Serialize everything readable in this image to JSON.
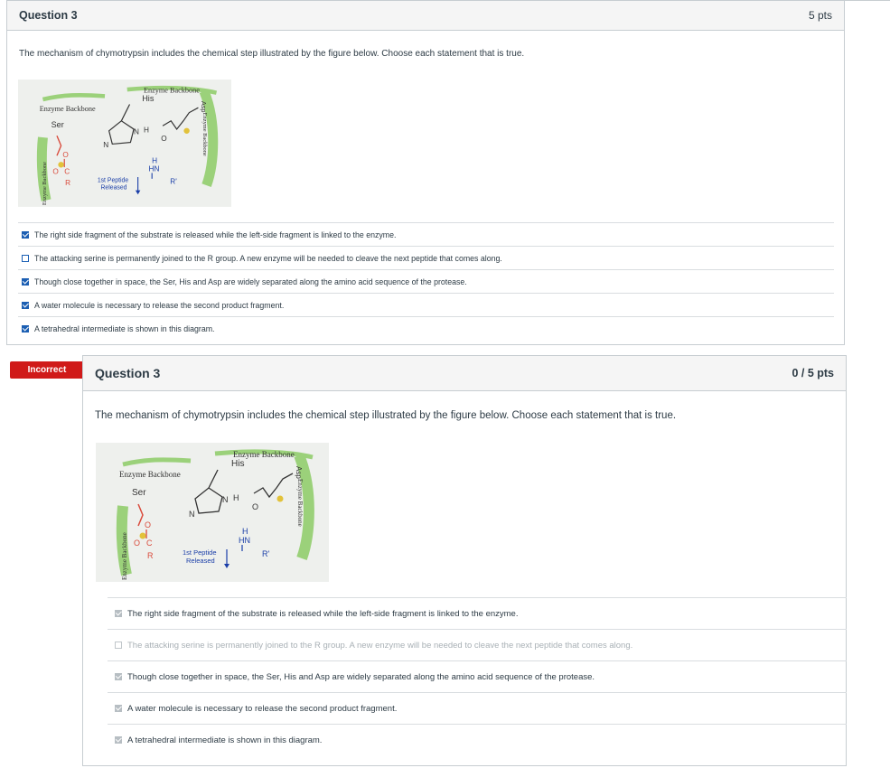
{
  "question1": {
    "title": "Question 3",
    "points": "5 pts",
    "prompt": "The mechanism of chymotrypsin includes the chemical step illustrated by the figure below.  Choose each statement that is true.",
    "answers": [
      {
        "label": "The right side fragment of the substrate is released while the left-side fragment is linked to the enzyme.",
        "checked": true
      },
      {
        "label": "The attacking serine is permanently joined to the R group. A new enzyme will be needed to cleave the next peptide that comes along.",
        "checked": false
      },
      {
        "label": "Though close together in space, the Ser, His and Asp are widely separated along the amino acid sequence of the protease.",
        "checked": true
      },
      {
        "label": "A water molecule is necessary to release the second product fragment.",
        "checked": true
      },
      {
        "label": "A tetrahedral intermediate is shown in this diagram.",
        "checked": true
      }
    ]
  },
  "result": {
    "badge": "Incorrect",
    "title": "Question 3",
    "points": "0 / 5 pts",
    "prompt": "The mechanism of chymotrypsin includes the chemical step illustrated by the figure below.  Choose each statement that is true.",
    "answers": [
      {
        "label": "The right side fragment of the substrate is released while the left-side fragment is linked to the enzyme.",
        "checked": true
      },
      {
        "label": "The attacking serine is permanently joined to the R group. A new enzyme will be needed to cleave the next peptide that comes along.",
        "checked": false
      },
      {
        "label": "Though close together in space, the Ser, His and Asp are widely separated along the amino acid sequence of the protease.",
        "checked": true
      },
      {
        "label": "A water molecule is necessary to release the second product fragment.",
        "checked": true
      },
      {
        "label": "A tetrahedral intermediate is shown in this diagram.",
        "checked": true
      }
    ]
  },
  "figure": {
    "enzyme_backbone_top": "Enzyme Backbone",
    "enzyme_backbone_left": "Enzyme Backbone",
    "enzyme_backbone_side": "Enzyme Backbone",
    "enzyme_backbone_right": "Enzyme Backbone",
    "his": "His",
    "asp": "Asp",
    "ser": "Ser",
    "n1": "N",
    "n2": "N",
    "h1": "H",
    "o_minus": "O",
    "o_ser": "O",
    "o_carbonyl": "O",
    "c": "C",
    "r": "R",
    "h2": "H",
    "hn": "HN",
    "r_prime": "R'",
    "peptide_line1": "1st Peptide",
    "peptide_line2": "Released"
  },
  "colors": {
    "backbone_green": "#9bd17a",
    "serine_red": "#d94b3c",
    "badge_red": "#d01a19",
    "checkbox_blue": "#1c5fb3"
  }
}
